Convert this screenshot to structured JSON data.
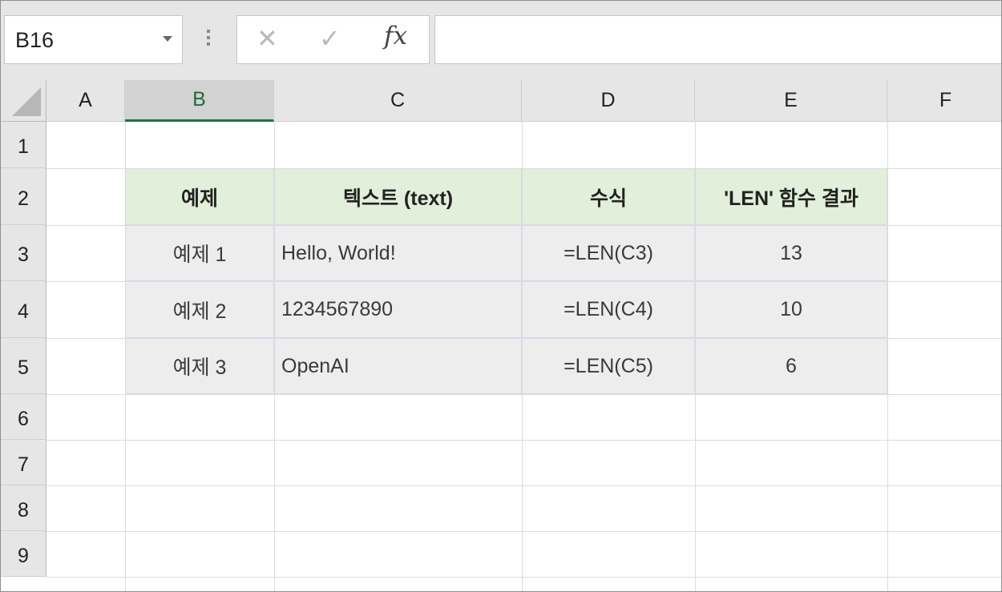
{
  "name_box": {
    "value": "B16"
  },
  "formula_bar": {
    "cancel_glyph": "✕",
    "enter_glyph": "✓",
    "fx_label": "fx",
    "value": ""
  },
  "columns": [
    "A",
    "B",
    "C",
    "D",
    "E",
    "F"
  ],
  "active_column": "B",
  "rows": [
    "1",
    "2",
    "3",
    "4",
    "5",
    "6",
    "7",
    "8",
    "9"
  ],
  "table": {
    "headers": [
      "예제",
      "텍스트 (text)",
      "수식",
      "'LEN' 함수 결과"
    ],
    "rows": [
      [
        "예제 1",
        "Hello, World!",
        "=LEN(C3)",
        "13"
      ],
      [
        "예제 2",
        "1234567890",
        "=LEN(C4)",
        "10"
      ],
      [
        "예제 3",
        "OpenAI",
        "=LEN(C5)",
        "6"
      ]
    ]
  },
  "colors": {
    "header_fill": "#e2efda",
    "body_fill": "#ededed",
    "active_header_text": "#1f6b3a",
    "active_underline": "#217346"
  },
  "icons": {
    "cancel": "close-icon",
    "enter": "check-icon",
    "function": "fx-icon",
    "name_box_dropdown": "chevron-down-icon",
    "select_all": "select-all-triangle-icon"
  }
}
